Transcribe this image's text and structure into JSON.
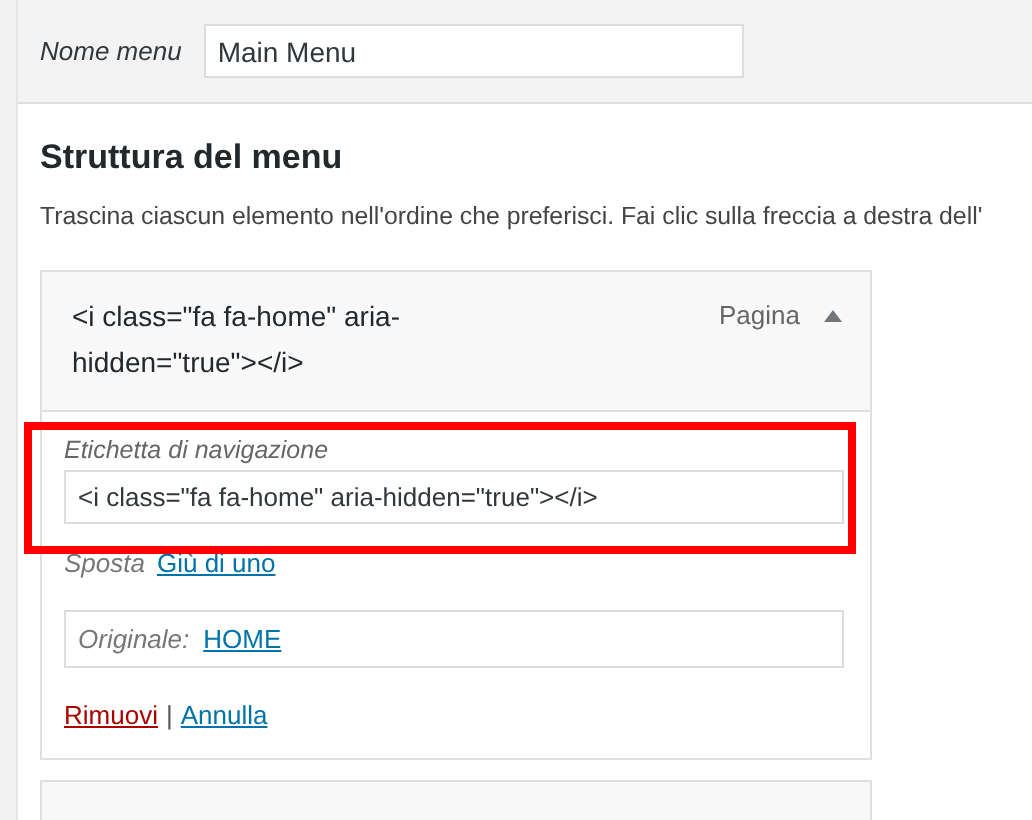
{
  "menu_name": {
    "label": "Nome menu",
    "value": "Main Menu"
  },
  "structure": {
    "title": "Struttura del menu",
    "description": "Trascina ciascun elemento nell'ordine che preferisci. Fai clic sulla freccia a destra dell'"
  },
  "items": [
    {
      "title": "<i class=\"fa fa-home\" aria-hidden=\"true\"></i>",
      "type_label": "Pagina",
      "expanded": true,
      "nav_label": {
        "label": "Etichetta di navigazione",
        "value": "<i class=\"fa fa-home\" aria-hidden=\"true\"></i>"
      },
      "move": {
        "label": "Sposta",
        "link": "Giù di uno"
      },
      "original": {
        "label": "Originale:",
        "link": "HOME"
      },
      "action_separator": "|",
      "actions": [
        {
          "kind": "remove",
          "label": "Rimuovi"
        },
        {
          "kind": "cancel",
          "label": "Annulla"
        }
      ]
    }
  ]
}
